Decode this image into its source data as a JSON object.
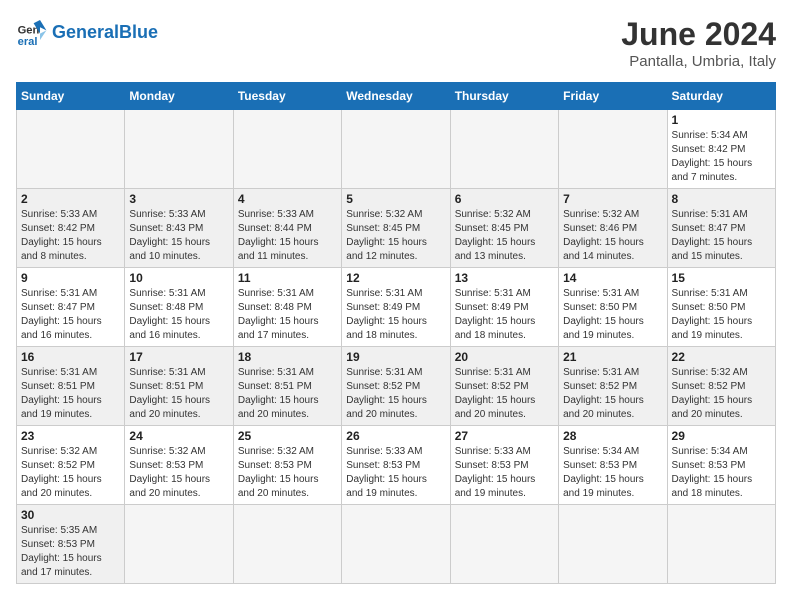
{
  "header": {
    "logo_general": "General",
    "logo_blue": "Blue",
    "title": "June 2024",
    "subtitle": "Pantalla, Umbria, Italy"
  },
  "days_of_week": [
    "Sunday",
    "Monday",
    "Tuesday",
    "Wednesday",
    "Thursday",
    "Friday",
    "Saturday"
  ],
  "weeks": [
    [
      {
        "day": "",
        "detail": ""
      },
      {
        "day": "",
        "detail": ""
      },
      {
        "day": "",
        "detail": ""
      },
      {
        "day": "",
        "detail": ""
      },
      {
        "day": "",
        "detail": ""
      },
      {
        "day": "",
        "detail": ""
      },
      {
        "day": "1",
        "detail": "Sunrise: 5:34 AM\nSunset: 8:42 PM\nDaylight: 15 hours\nand 7 minutes."
      }
    ],
    [
      {
        "day": "2",
        "detail": "Sunrise: 5:33 AM\nSunset: 8:42 PM\nDaylight: 15 hours\nand 8 minutes."
      },
      {
        "day": "3",
        "detail": "Sunrise: 5:33 AM\nSunset: 8:43 PM\nDaylight: 15 hours\nand 10 minutes."
      },
      {
        "day": "4",
        "detail": "Sunrise: 5:33 AM\nSunset: 8:44 PM\nDaylight: 15 hours\nand 11 minutes."
      },
      {
        "day": "5",
        "detail": "Sunrise: 5:32 AM\nSunset: 8:45 PM\nDaylight: 15 hours\nand 12 minutes."
      },
      {
        "day": "6",
        "detail": "Sunrise: 5:32 AM\nSunset: 8:45 PM\nDaylight: 15 hours\nand 13 minutes."
      },
      {
        "day": "7",
        "detail": "Sunrise: 5:32 AM\nSunset: 8:46 PM\nDaylight: 15 hours\nand 14 minutes."
      },
      {
        "day": "8",
        "detail": "Sunrise: 5:31 AM\nSunset: 8:47 PM\nDaylight: 15 hours\nand 15 minutes."
      }
    ],
    [
      {
        "day": "9",
        "detail": "Sunrise: 5:31 AM\nSunset: 8:47 PM\nDaylight: 15 hours\nand 16 minutes."
      },
      {
        "day": "10",
        "detail": "Sunrise: 5:31 AM\nSunset: 8:48 PM\nDaylight: 15 hours\nand 16 minutes."
      },
      {
        "day": "11",
        "detail": "Sunrise: 5:31 AM\nSunset: 8:48 PM\nDaylight: 15 hours\nand 17 minutes."
      },
      {
        "day": "12",
        "detail": "Sunrise: 5:31 AM\nSunset: 8:49 PM\nDaylight: 15 hours\nand 18 minutes."
      },
      {
        "day": "13",
        "detail": "Sunrise: 5:31 AM\nSunset: 8:49 PM\nDaylight: 15 hours\nand 18 minutes."
      },
      {
        "day": "14",
        "detail": "Sunrise: 5:31 AM\nSunset: 8:50 PM\nDaylight: 15 hours\nand 19 minutes."
      },
      {
        "day": "15",
        "detail": "Sunrise: 5:31 AM\nSunset: 8:50 PM\nDaylight: 15 hours\nand 19 minutes."
      }
    ],
    [
      {
        "day": "16",
        "detail": "Sunrise: 5:31 AM\nSunset: 8:51 PM\nDaylight: 15 hours\nand 19 minutes."
      },
      {
        "day": "17",
        "detail": "Sunrise: 5:31 AM\nSunset: 8:51 PM\nDaylight: 15 hours\nand 20 minutes."
      },
      {
        "day": "18",
        "detail": "Sunrise: 5:31 AM\nSunset: 8:51 PM\nDaylight: 15 hours\nand 20 minutes."
      },
      {
        "day": "19",
        "detail": "Sunrise: 5:31 AM\nSunset: 8:52 PM\nDaylight: 15 hours\nand 20 minutes."
      },
      {
        "day": "20",
        "detail": "Sunrise: 5:31 AM\nSunset: 8:52 PM\nDaylight: 15 hours\nand 20 minutes."
      },
      {
        "day": "21",
        "detail": "Sunrise: 5:31 AM\nSunset: 8:52 PM\nDaylight: 15 hours\nand 20 minutes."
      },
      {
        "day": "22",
        "detail": "Sunrise: 5:32 AM\nSunset: 8:52 PM\nDaylight: 15 hours\nand 20 minutes."
      }
    ],
    [
      {
        "day": "23",
        "detail": "Sunrise: 5:32 AM\nSunset: 8:52 PM\nDaylight: 15 hours\nand 20 minutes."
      },
      {
        "day": "24",
        "detail": "Sunrise: 5:32 AM\nSunset: 8:53 PM\nDaylight: 15 hours\nand 20 minutes."
      },
      {
        "day": "25",
        "detail": "Sunrise: 5:32 AM\nSunset: 8:53 PM\nDaylight: 15 hours\nand 20 minutes."
      },
      {
        "day": "26",
        "detail": "Sunrise: 5:33 AM\nSunset: 8:53 PM\nDaylight: 15 hours\nand 19 minutes."
      },
      {
        "day": "27",
        "detail": "Sunrise: 5:33 AM\nSunset: 8:53 PM\nDaylight: 15 hours\nand 19 minutes."
      },
      {
        "day": "28",
        "detail": "Sunrise: 5:34 AM\nSunset: 8:53 PM\nDaylight: 15 hours\nand 19 minutes."
      },
      {
        "day": "29",
        "detail": "Sunrise: 5:34 AM\nSunset: 8:53 PM\nDaylight: 15 hours\nand 18 minutes."
      }
    ],
    [
      {
        "day": "30",
        "detail": "Sunrise: 5:35 AM\nSunset: 8:53 PM\nDaylight: 15 hours\nand 17 minutes."
      },
      {
        "day": "",
        "detail": ""
      },
      {
        "day": "",
        "detail": ""
      },
      {
        "day": "",
        "detail": ""
      },
      {
        "day": "",
        "detail": ""
      },
      {
        "day": "",
        "detail": ""
      },
      {
        "day": "",
        "detail": ""
      }
    ]
  ]
}
